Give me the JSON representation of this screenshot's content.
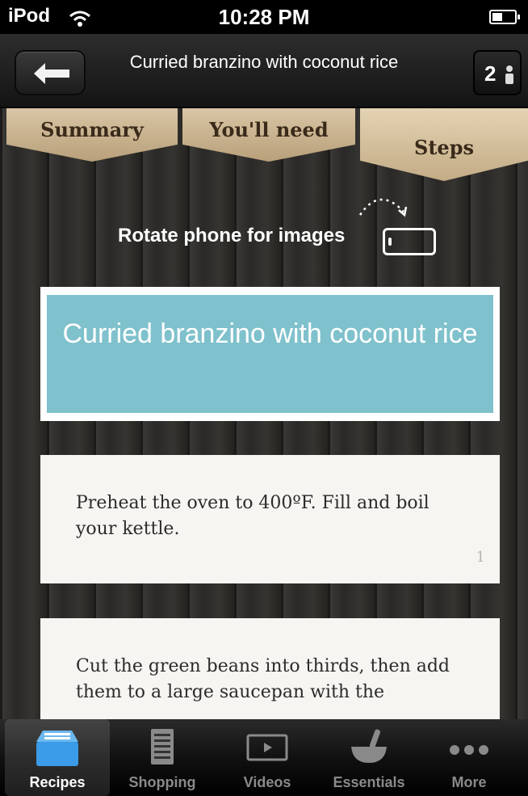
{
  "status_bar": {
    "carrier": "iPod",
    "time": "10:28 PM"
  },
  "nav": {
    "title": "Curried branzino with coconut rice",
    "servings": "2"
  },
  "tabs": [
    {
      "label": "Summary"
    },
    {
      "label": "You'll need"
    },
    {
      "label": "Steps",
      "active": true
    }
  ],
  "rotate_hint": "Rotate phone for images",
  "recipe_title": "Curried branzino with coconut rice",
  "steps": [
    {
      "number": "1",
      "text": "Preheat the oven to 400ºF. Fill and boil your kettle."
    },
    {
      "text": "Cut the green beans into thirds, then add them to a large saucepan with the"
    }
  ],
  "tab_bar": [
    {
      "label": "Recipes",
      "icon": "recipe-box-icon",
      "active": true
    },
    {
      "label": "Shopping",
      "icon": "shopping-list-icon"
    },
    {
      "label": "Videos",
      "icon": "video-icon"
    },
    {
      "label": "Essentials",
      "icon": "mortar-pestle-icon"
    },
    {
      "label": "More",
      "icon": "more-dots-icon"
    }
  ],
  "colors": {
    "accent_title": "#7fc1cc",
    "tab_paper": "#d0bb97",
    "active_tab_icon": "#3a9be8"
  }
}
